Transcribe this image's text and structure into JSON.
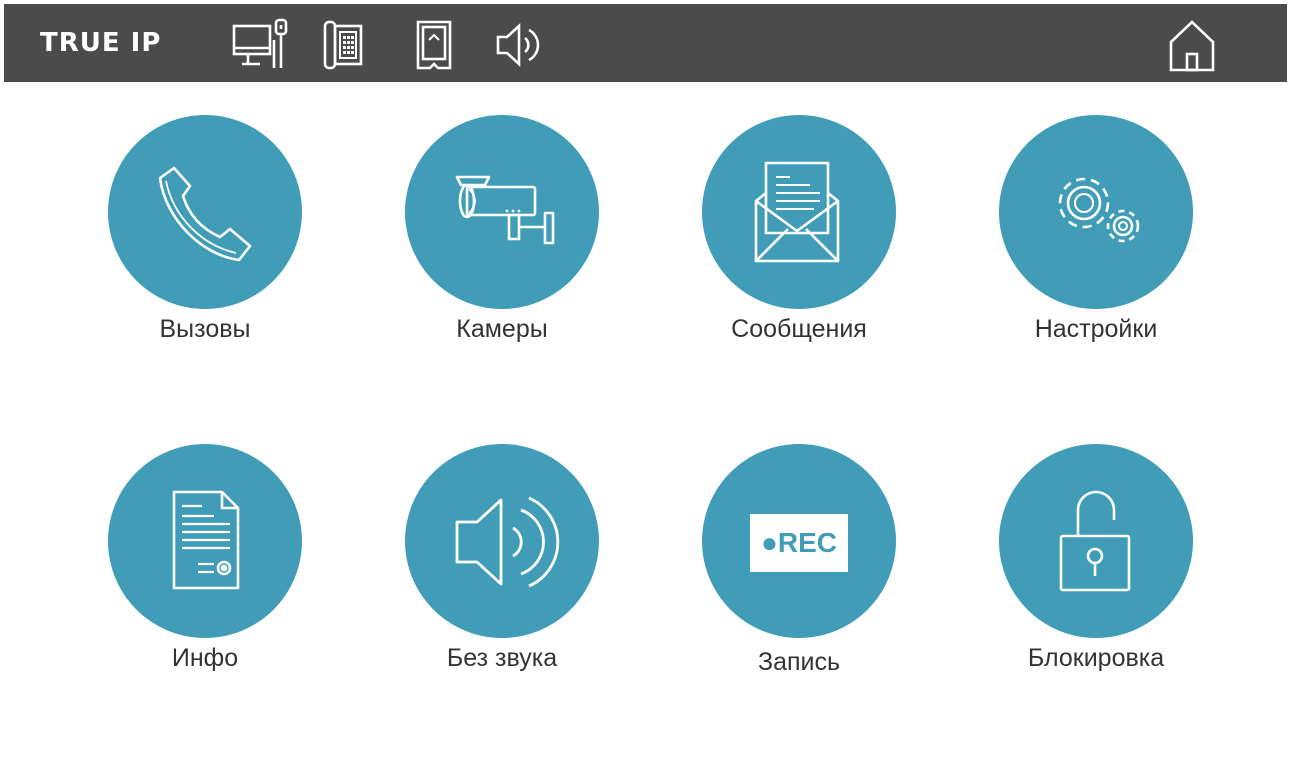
{
  "header": {
    "brand": "TRUE IP",
    "status_icons": [
      "monitor-icon",
      "intercom-handset-icon",
      "sd-card-icon",
      "speaker-icon"
    ],
    "home_icon": "home-icon"
  },
  "colors": {
    "topbar": "#4b4b4b",
    "tile_accent": "#419db7",
    "label_text": "#333333",
    "icon_stroke": "#ffffff"
  },
  "menu": {
    "items": [
      {
        "label": "Вызовы",
        "icon": "phone-icon"
      },
      {
        "label": "Камеры",
        "icon": "camera-icon"
      },
      {
        "label": "Сообщения",
        "icon": "envelope-icon"
      },
      {
        "label": "Настройки",
        "icon": "gears-icon"
      },
      {
        "label": "Инфо",
        "icon": "document-icon"
      },
      {
        "label": "Без звука",
        "icon": "speaker-icon"
      },
      {
        "label": "Запись",
        "icon": "rec-icon",
        "badge": "●REC"
      },
      {
        "label": "Блокировка",
        "icon": "unlocked-padlock-icon"
      }
    ]
  }
}
